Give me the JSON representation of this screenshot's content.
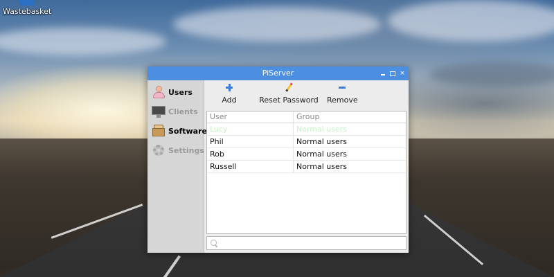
{
  "desktop": {
    "icons": [
      {
        "label": "Wastebasket",
        "icon": "trash-icon"
      }
    ]
  },
  "window": {
    "title": "PiServer",
    "buttons": {
      "minimize": "minimize",
      "maximize": "maximize",
      "close": "×"
    }
  },
  "sidebar": {
    "items": [
      {
        "label": "Users",
        "icon": "users-icon",
        "state": "active"
      },
      {
        "label": "Clients",
        "icon": "monitor-icon",
        "state": "disabled"
      },
      {
        "label": "Software",
        "icon": "package-icon",
        "state": "normal"
      },
      {
        "label": "Settings",
        "icon": "gear-icon",
        "state": "disabled"
      }
    ]
  },
  "toolbar": {
    "add_label": "Add",
    "reset_password_label": "Reset Password",
    "remove_label": "Remove"
  },
  "users_table": {
    "columns": [
      "User",
      "Group"
    ],
    "rows": [
      {
        "user": "Lucy",
        "group": "Normal users"
      },
      {
        "user": "Phil",
        "group": "Normal users"
      },
      {
        "user": "Rob",
        "group": "Normal users"
      },
      {
        "user": "Russell",
        "group": "Normal users"
      }
    ]
  },
  "search": {
    "value": "",
    "placeholder": ""
  },
  "colors": {
    "titlebar": "#4c8fe0",
    "accent": "#3d7cd3"
  }
}
